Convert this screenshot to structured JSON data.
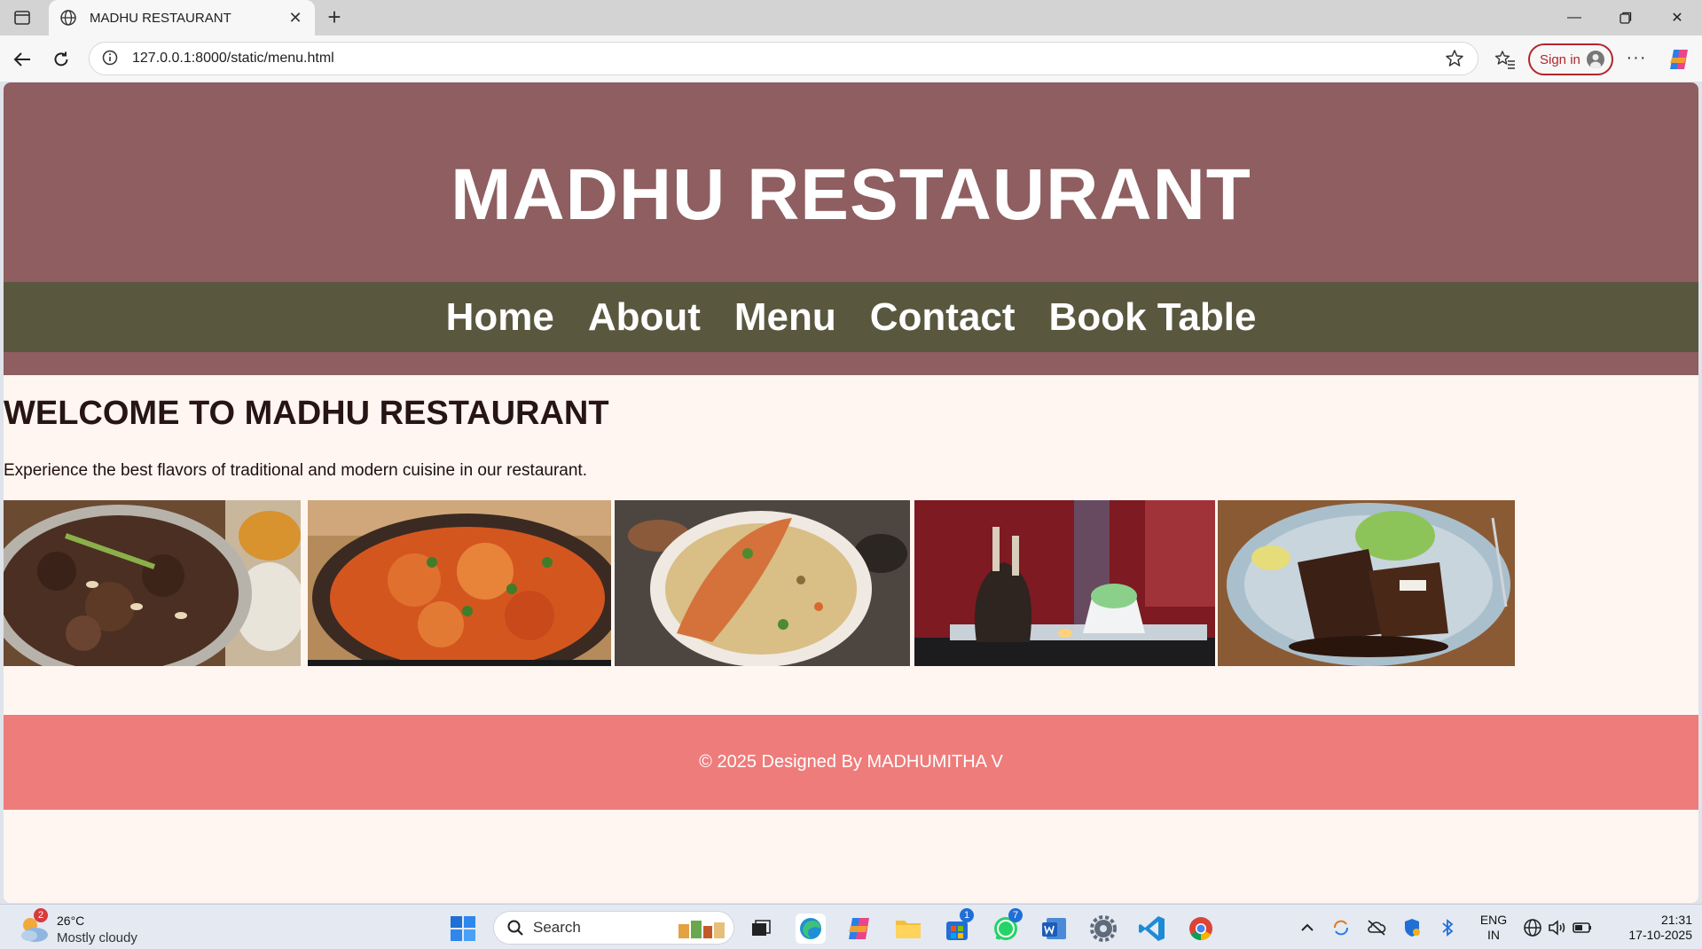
{
  "browser": {
    "tab_title": "MADHU RESTAURANT",
    "url": "127.0.0.1:8000/static/menu.html",
    "signin_label": "Sign in",
    "new_tab_icon": "plus-icon",
    "close_tab_icon": "close-icon"
  },
  "site": {
    "title": "MADHU RESTAURANT",
    "nav": [
      "Home",
      "About",
      "Menu",
      "Contact",
      "Book Table"
    ],
    "welcome_heading": "WELCOME TO MADHU RESTAURANT",
    "tagline": "Experience the best flavors of traditional and modern cuisine in our restaurant.",
    "photos": [
      {
        "name": "mutton-curry-photo"
      },
      {
        "name": "butter-chicken-photo"
      },
      {
        "name": "fish-biryani-photo"
      },
      {
        "name": "grilled-lamb-chops-photo"
      },
      {
        "name": "pork-ribs-photo"
      }
    ],
    "footer": "© 2025 Designed By MADHUMITHA V",
    "colors": {
      "header": "#8e5e60",
      "nav": "#5a573f",
      "background": "#fff6f1",
      "footer": "#ee7c7b"
    }
  },
  "taskbar": {
    "weather_temp": "26°C",
    "weather_condition": "Mostly cloudy",
    "weather_badge": "2",
    "search_label": "Search",
    "store_badge": "1",
    "whatsapp_badge": "7",
    "lang_line1": "ENG",
    "lang_line2": "IN",
    "time": "21:31",
    "date": "17-10-2025"
  }
}
